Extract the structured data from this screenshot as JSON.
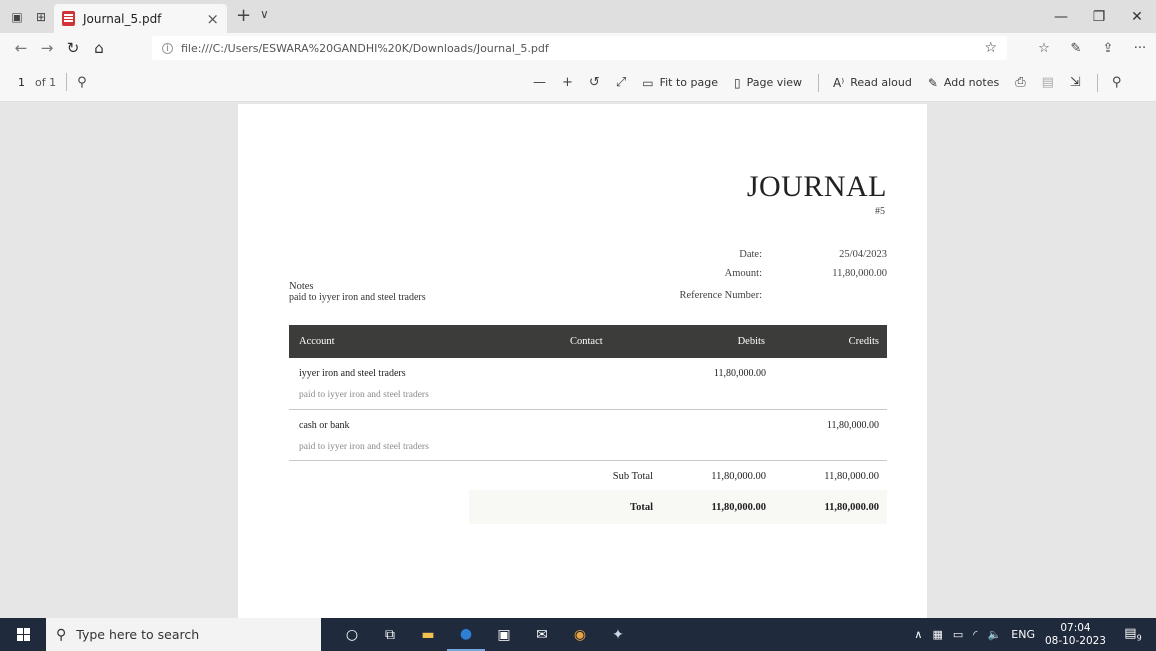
{
  "browser": {
    "tab_title": "Journal_5.pdf",
    "url": "file:///C:/Users/ESWARA%20GANDHI%20K/Downloads/Journal_5.pdf"
  },
  "pdf_toolbar": {
    "page_number": "1",
    "page_total": "of 1",
    "fit_to_page": "Fit to page",
    "page_view": "Page view",
    "read_aloud": "Read aloud",
    "add_notes": "Add notes"
  },
  "document": {
    "title": "JOURNAL",
    "number": "#5",
    "date_label": "Date:",
    "date_value": "25/04/2023",
    "amount_label": "Amount:",
    "amount_value": "11,80,000.00",
    "reference_label": "Reference Number:",
    "notes_label": "Notes",
    "notes_value": "paid to iyyer iron and steel traders",
    "table": {
      "headers": [
        "Account",
        "Contact",
        "Debits",
        "Credits"
      ],
      "rows": [
        {
          "account": "iyyer iron and steel traders",
          "description": "paid to iyyer iron and steel traders",
          "debit": "11,80,000.00",
          "credit": ""
        },
        {
          "account": "cash or bank",
          "description": "paid to iyyer iron and steel traders",
          "debit": "",
          "credit": "11,80,000.00"
        }
      ],
      "subtotal_label": "Sub Total",
      "subtotal_debit": "11,80,000.00",
      "subtotal_credit": "11,80,000.00",
      "total_label": "Total",
      "total_debit": "11,80,000.00",
      "total_credit": "11,80,000.00"
    }
  },
  "taskbar": {
    "search_placeholder": "Type here to search",
    "language": "ENG",
    "time": "07:04",
    "date": "08-10-2023",
    "notification_count": "9"
  }
}
